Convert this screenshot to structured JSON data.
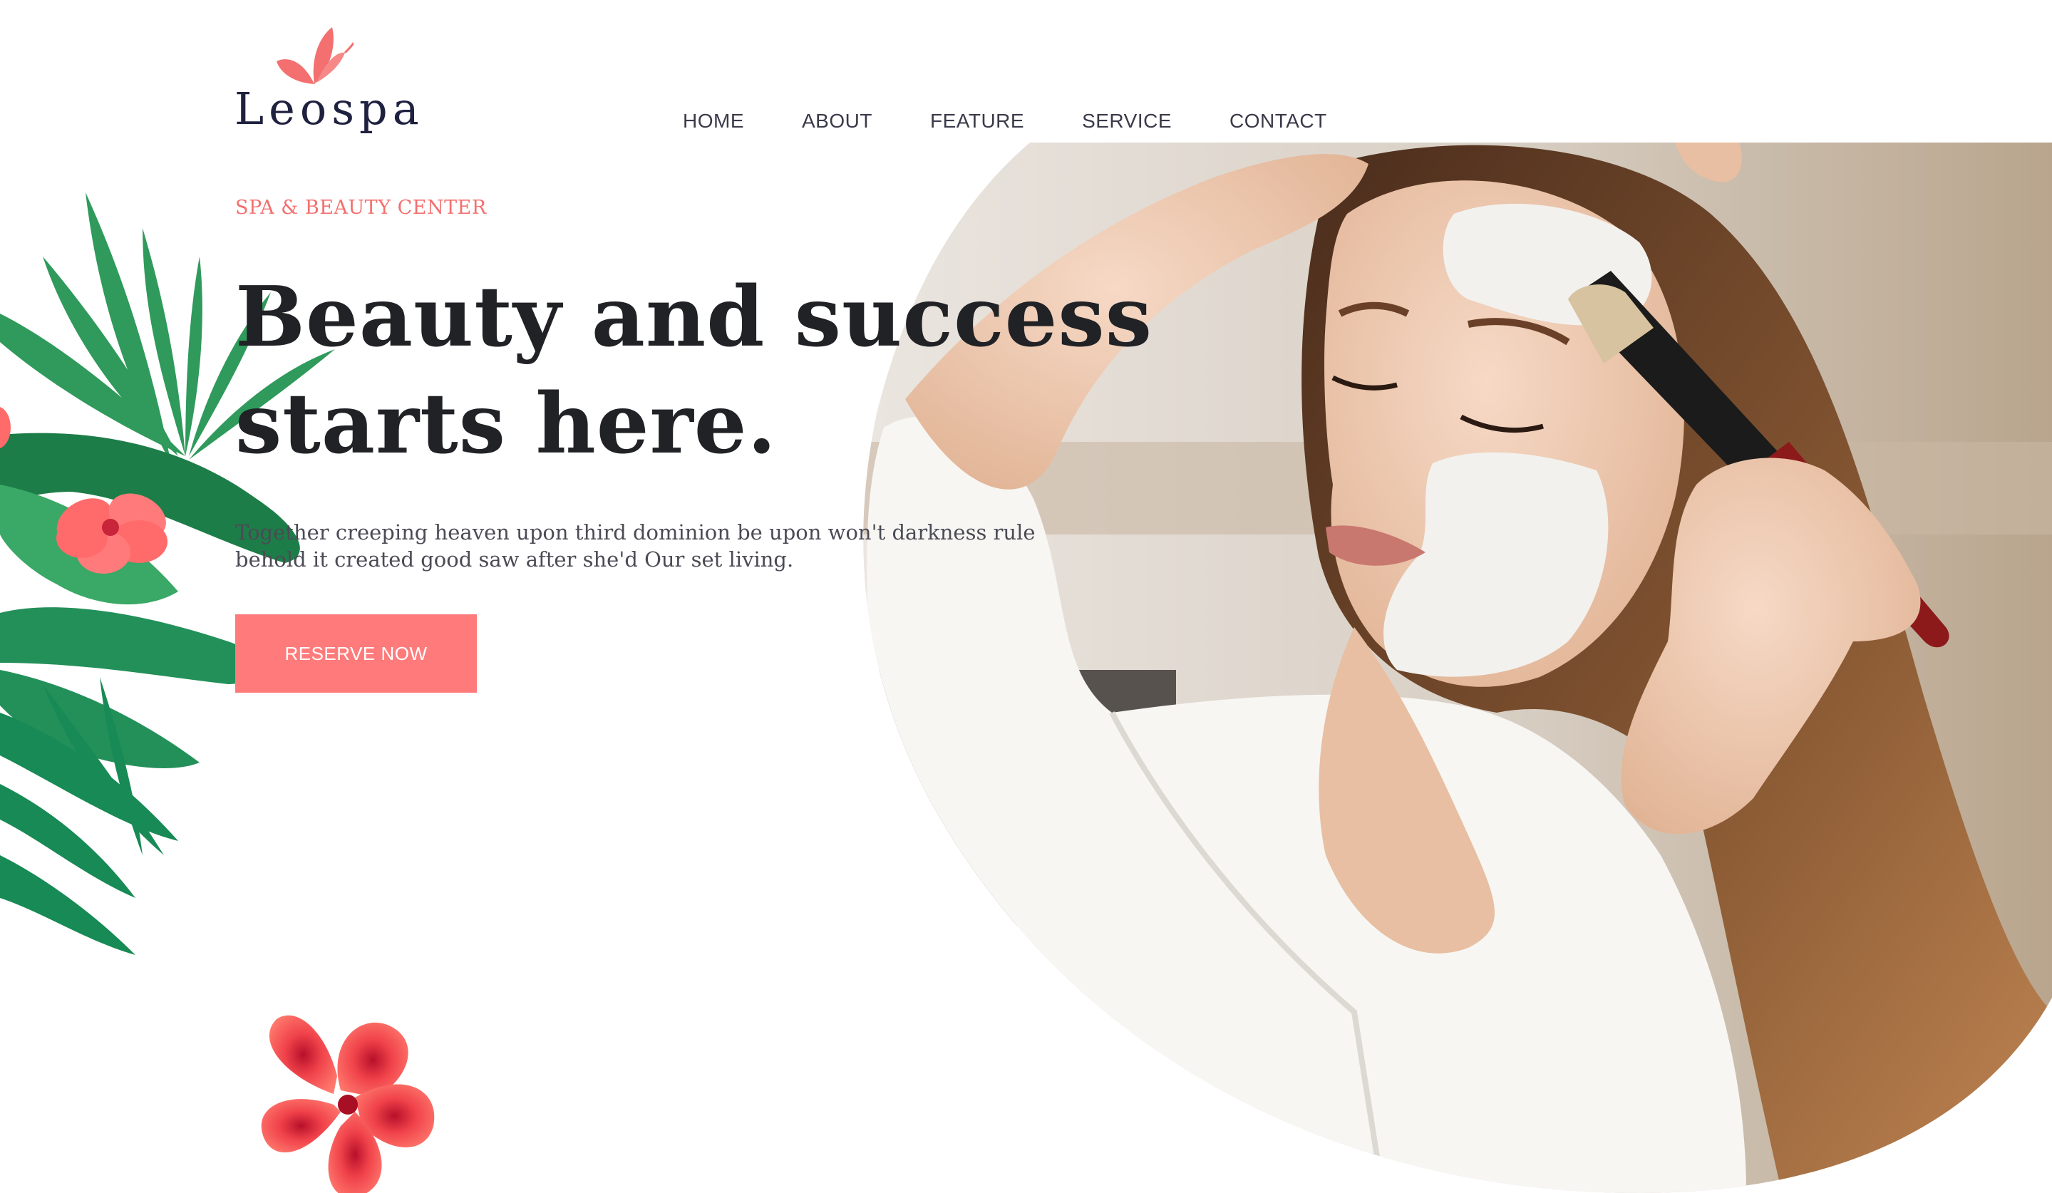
{
  "brand": {
    "name": "Leospa",
    "logo_icon": "butterfly-icon",
    "logo_color": "#f46f6f",
    "text_color": "#1f2140"
  },
  "nav": {
    "items": [
      {
        "label": "HOME"
      },
      {
        "label": "ABOUT"
      },
      {
        "label": "FEATURE"
      },
      {
        "label": "SERVICE"
      },
      {
        "label": "CONTACT"
      }
    ]
  },
  "hero": {
    "kicker": "SPA & BEAUTY CENTER",
    "headline_line1": "Beauty and success",
    "headline_line2": "starts here.",
    "lead_line1": "Together creeping heaven upon third dominion be upon won't darkness rule",
    "lead_line2": "behold it created good saw after she'd Our set living.",
    "cta_label": "RESERVE NOW",
    "accent_color": "#ff7b7b",
    "image": "woman-face-mask-photo",
    "decor_left": "tropical-leaves-illustration",
    "decor_bottom": "red-hibiscus-flower-illustration"
  }
}
